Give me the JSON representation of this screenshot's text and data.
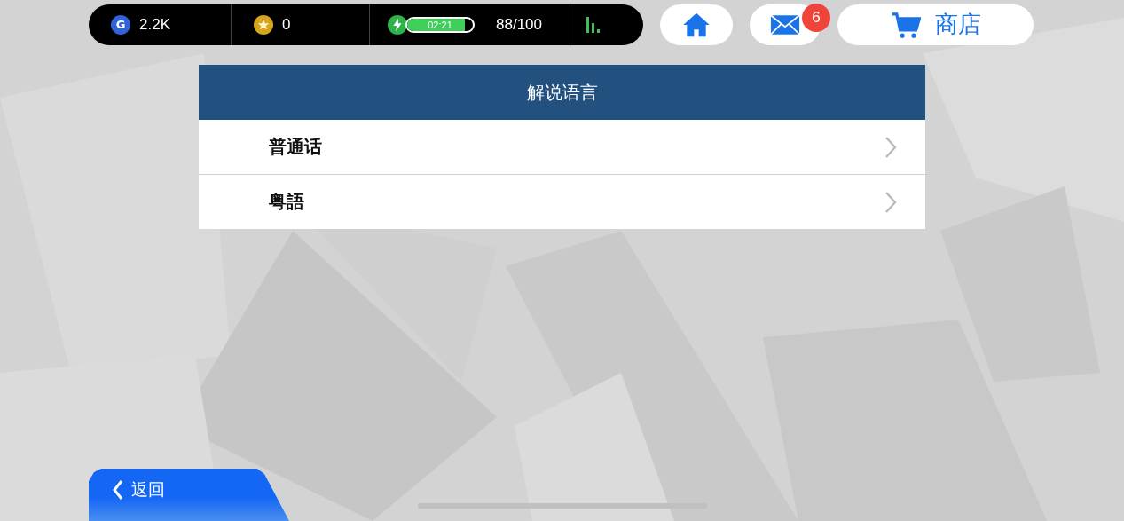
{
  "status_bar": {
    "currencies": [
      {
        "kind": "g",
        "icon": "G",
        "value": "2.2K"
      },
      {
        "kind": "star",
        "value": "0"
      }
    ],
    "energy": {
      "timer": "02:21",
      "level": 0.88,
      "count": "88/100"
    }
  },
  "nav": {
    "mail_badge": "6",
    "shop_label": "商店"
  },
  "panel": {
    "title": "解说语言",
    "options": [
      {
        "label": "普通话"
      },
      {
        "label": "粤語"
      }
    ]
  },
  "back_button": {
    "label": "返回"
  }
}
